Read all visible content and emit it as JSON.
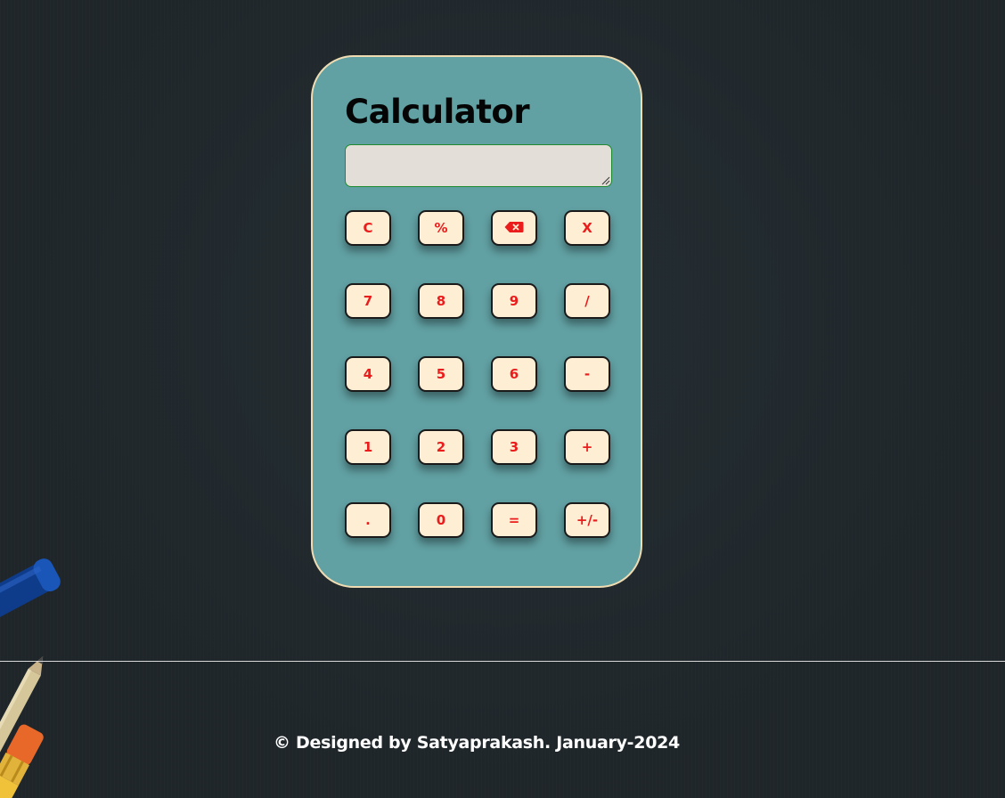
{
  "calculator": {
    "title": "Calculator",
    "display_value": "",
    "keys": [
      {
        "label": "C",
        "name": "clear-button"
      },
      {
        "label": "%",
        "name": "percent-button"
      },
      {
        "label": "",
        "icon": "backspace-icon",
        "name": "backspace-button"
      },
      {
        "label": "X",
        "name": "multiply-button"
      },
      {
        "label": "7",
        "name": "digit-7-button"
      },
      {
        "label": "8",
        "name": "digit-8-button"
      },
      {
        "label": "9",
        "name": "digit-9-button"
      },
      {
        "label": "/",
        "name": "divide-button"
      },
      {
        "label": "4",
        "name": "digit-4-button"
      },
      {
        "label": "5",
        "name": "digit-5-button"
      },
      {
        "label": "6",
        "name": "digit-6-button"
      },
      {
        "label": "-",
        "name": "subtract-button"
      },
      {
        "label": "1",
        "name": "digit-1-button"
      },
      {
        "label": "2",
        "name": "digit-2-button"
      },
      {
        "label": "3",
        "name": "digit-3-button"
      },
      {
        "label": "+",
        "name": "add-button"
      },
      {
        "label": ".",
        "name": "decimal-button"
      },
      {
        "label": "0",
        "name": "digit-0-button"
      },
      {
        "label": "=",
        "name": "equals-button"
      },
      {
        "label": "+/-",
        "name": "negate-button"
      }
    ]
  },
  "footer": {
    "text": "© Designed by Satyaprakash. January-2024"
  },
  "colors": {
    "background": "#1f262a",
    "card": "#61a0a3",
    "card_border": "#efdcb2",
    "key_background": "#feeed4",
    "key_text": "#ea1c1c",
    "display_background": "#e3ded8"
  }
}
